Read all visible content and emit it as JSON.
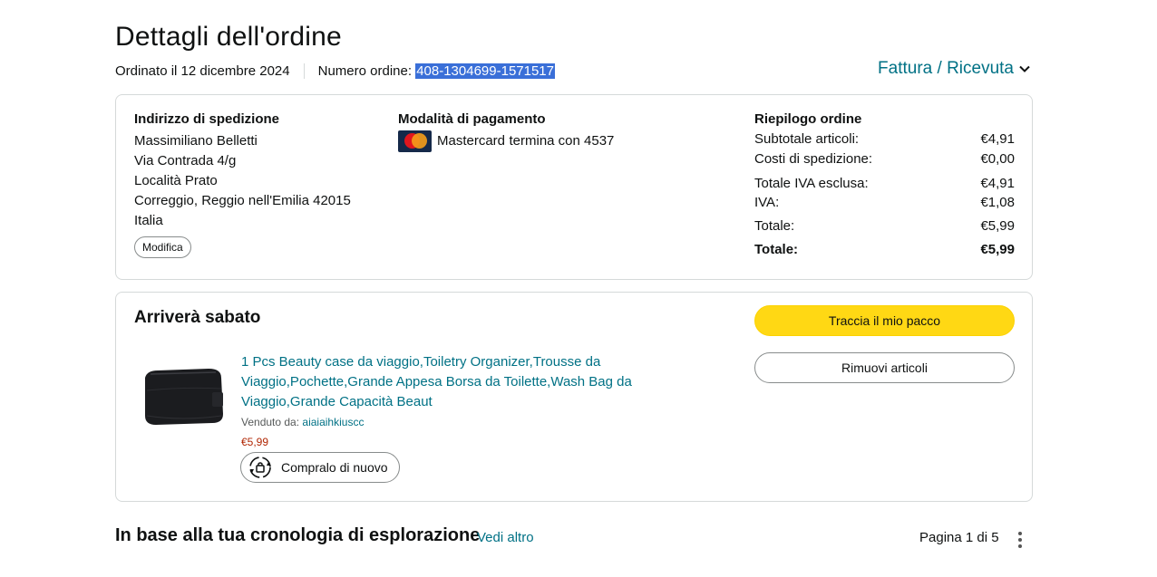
{
  "page": {
    "title": "Dettagli dell'ordine",
    "ordered_on": "Ordinato il 12 dicembre 2024",
    "order_number_label": "Numero ordine:",
    "order_number": "408-1304699-1571517",
    "invoice_link": "Fattura / Ricevuta"
  },
  "shipping": {
    "title": "Indirizzo di spedizione",
    "name": "Massimiliano Belletti",
    "line1": "Via Contrada 4/g",
    "line2": "Località Prato",
    "line3": "Correggio, Reggio nell'Emilia 42015",
    "country": "Italia",
    "edit_label": "Modifica"
  },
  "payment": {
    "title": "Modalità di pagamento",
    "card_brand": "Mastercard",
    "card_text": "termina con 4537"
  },
  "summary": {
    "title": "Riepilogo ordine",
    "rows": [
      {
        "label": "Subtotale articoli:",
        "value": "€4,91"
      },
      {
        "label": "Costi di spedizione:",
        "value": "€0,00"
      },
      {
        "label": "Totale IVA esclusa:",
        "value": "€4,91"
      },
      {
        "label": "IVA:",
        "value": "€1,08"
      },
      {
        "label": "Totale:",
        "value": "€5,99"
      },
      {
        "label": "Totale:",
        "value": "€5,99"
      }
    ]
  },
  "shipment": {
    "status": "Arriverà sabato",
    "product_title": "1 Pcs Beauty case da viaggio,Toiletry Organizer,Trousse da Viaggio,Pochette,Grande Appesa Borsa da Toilette,Wash Bag da Viaggio,Grande Capacità Beaut",
    "sold_by_label": "Venduto da:",
    "seller": "aiaiaihkiuscc",
    "price": "€5,99",
    "buy_again_label": "Compralo di nuovo",
    "track_label": "Traccia il mio pacco",
    "remove_label": "Rimuovi articoli"
  },
  "history": {
    "title": "In base alla tua cronologia di esplorazione",
    "see_more": "Vedi altro",
    "pager": "Pagina 1 di 5"
  },
  "colors": {
    "link": "#007185",
    "primary_button": "#ffd814",
    "price": "#b12704",
    "selection": "#3a6fd8"
  },
  "icons": [
    "chevron-down-icon",
    "mastercard-icon",
    "buy-again-icon",
    "kebab-menu-icon"
  ]
}
